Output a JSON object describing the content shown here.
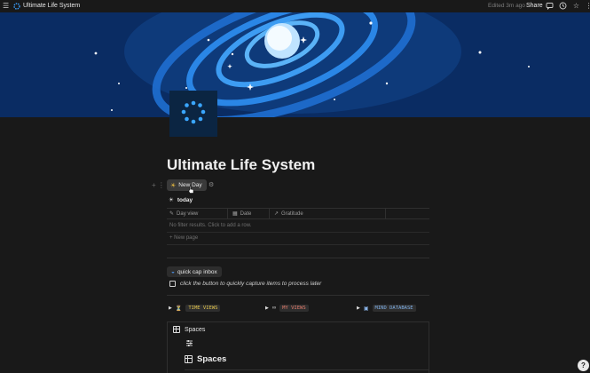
{
  "topbar": {
    "page_title": "Ultimate Life System",
    "edited": "Edited 3m ago",
    "share_label": "Share",
    "menu_icon": "hamburger-menu-icon",
    "comment_icon": "comment-icon",
    "clock_icon": "clock-icon",
    "favorite_icon": "star-icon",
    "more_icon": "more-icon"
  },
  "page": {
    "title": "Ultimate Life System",
    "accent_color": "#1f6fd1"
  },
  "new_day_button": {
    "label": "New Day",
    "icon": "sun-icon"
  },
  "view": {
    "label": "today",
    "icon": "sun-icon"
  },
  "table": {
    "columns": [
      {
        "label": "Day view",
        "icon": "edit-icon"
      },
      {
        "label": "Date",
        "icon": "calendar-icon"
      },
      {
        "label": "Gratitude",
        "icon": "arrow-icon"
      }
    ],
    "empty_text": "No filter results. Click to add a row.",
    "new_page_label": "New page"
  },
  "quick_capture": {
    "button_label": "quick cap inbox",
    "todo_text": "click the button to quickly capture items to process later"
  },
  "toggles": [
    {
      "label": "TIME VIEWS",
      "color": "#e0c24a"
    },
    {
      "label": "MY VIEWS",
      "color": "#e07a6a"
    },
    {
      "label": "MIND DATABASE",
      "color": "#7fb0e8"
    }
  ],
  "spaces": {
    "label": "Spaces",
    "heading": "Spaces"
  },
  "help_label": "?"
}
